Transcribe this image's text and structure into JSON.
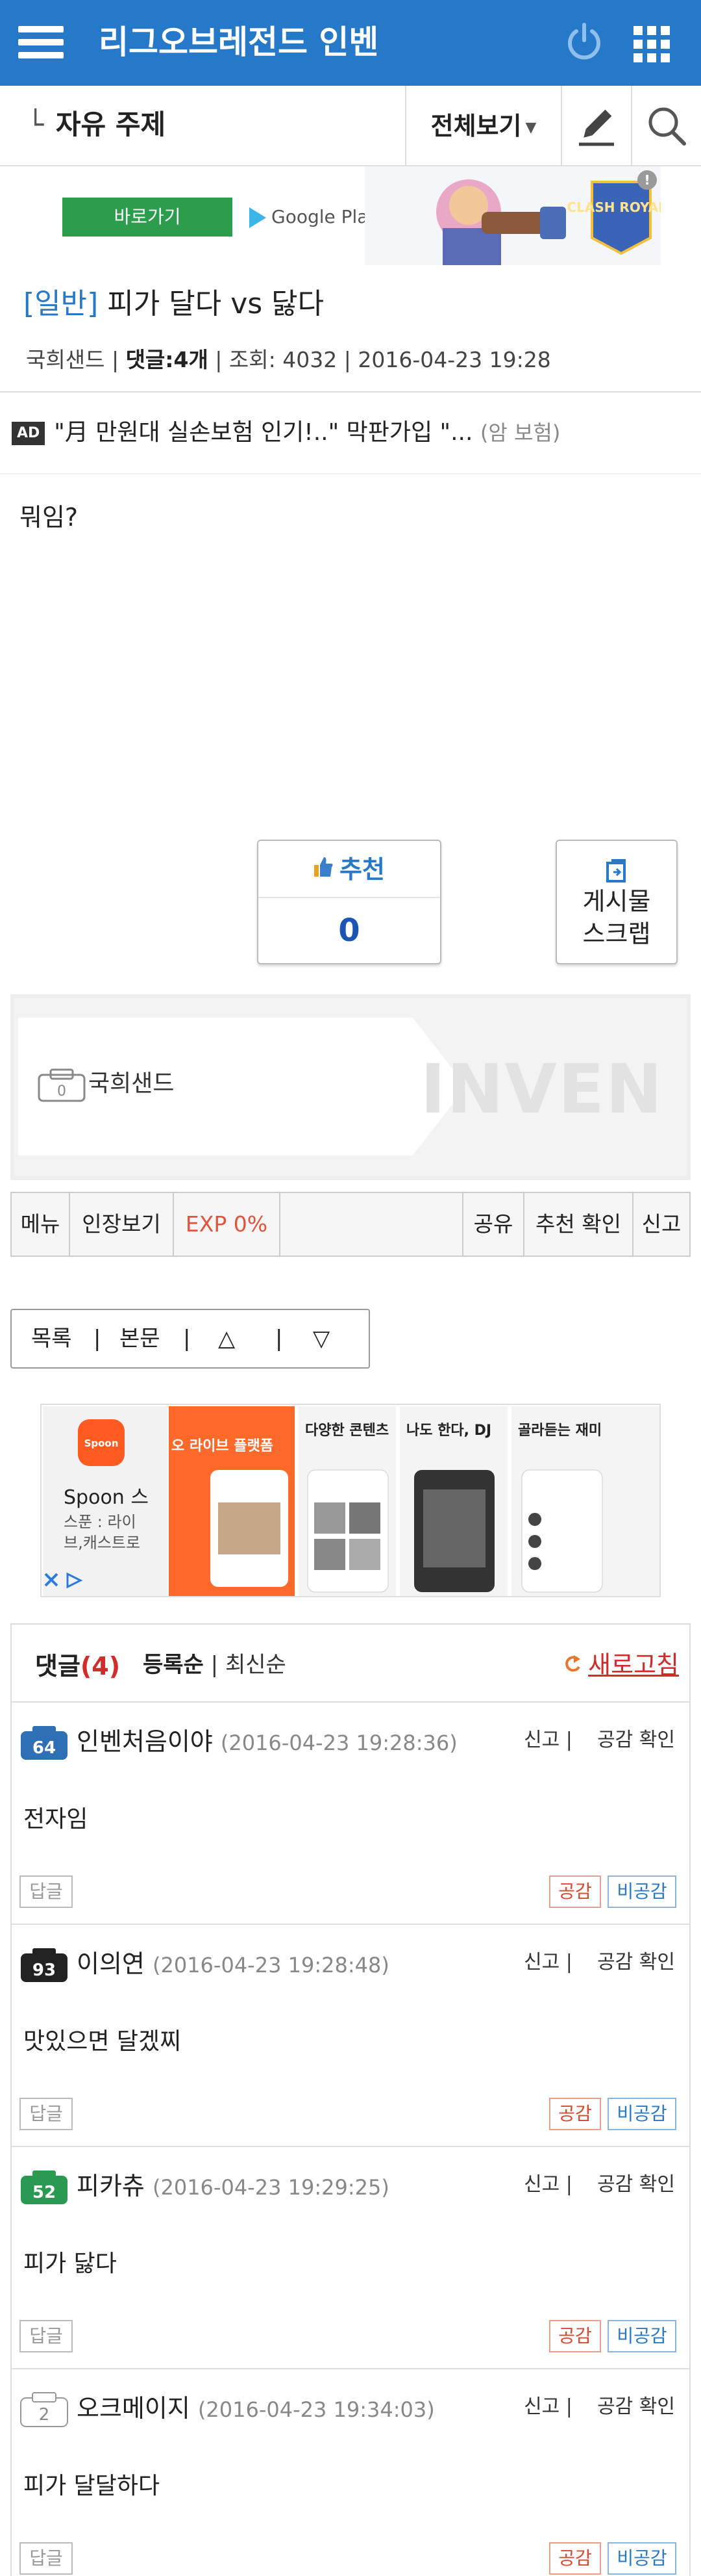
{
  "app": {
    "title": "리그오브레전드 인벤"
  },
  "subnav": {
    "breadcrumb_mark": "└",
    "board": "자유 주제",
    "view_all": "전체보기",
    "caret": "▼"
  },
  "top_ad": {
    "button": "바로가기",
    "store": "Google Play",
    "game_logo": "CLASH ROYALE",
    "info": "!"
  },
  "post": {
    "category": "[일반]",
    "title": "피가 달다 vs 닳다",
    "author": "국희샌드",
    "comments_label": "댓글:",
    "comments_count": "4개",
    "views_label": "조회:",
    "views": "4032",
    "date": "2016-04-23 19:28",
    "body": "뭐임?"
  },
  "text_ad": {
    "tag": "AD",
    "headline": "\"月 만원대 실손보험 인기!..\" 막판가입 \"...",
    "source": "(암 보험)"
  },
  "recommend": {
    "label": "추천",
    "count": "0"
  },
  "scrap": {
    "line1": "게시물",
    "line2": "스크랩"
  },
  "author_box": {
    "name": "국희샌드",
    "watermark": "INVEN"
  },
  "toolbar": {
    "menu": "메뉴",
    "seal": "인장보기",
    "exp": "EXP 0%",
    "share": "공유",
    "rec_check": "추천 확인",
    "report": "신고"
  },
  "nav": {
    "list": "목록",
    "body": "본문",
    "sep": "|",
    "up": "△",
    "down": "▽"
  },
  "spoon_ad": {
    "brand": "Spoon",
    "name": "Spoon 스",
    "desc1": "스푼 : 라이",
    "desc2": "브,캐스트로",
    "banner": "오 라이브 플랫폼",
    "shot2_title": "다양한 콘텐츠",
    "shot3_title": "나도 한다, DJ",
    "shot4_title": "골라듣는 재미"
  },
  "comments": {
    "title": "댓글",
    "count": "(4)",
    "sort_reg": "등록순",
    "sort_sep": "|",
    "sort_new": "최신순",
    "refresh": "새로고침",
    "report": "신고 |",
    "like_check": "공감 확인",
    "reply": "답글",
    "agree": "공감",
    "disagree": "비공감",
    "items": [
      {
        "level": "64",
        "nick": "인벤처음이야",
        "date": "(2016-04-23 19:28:36)",
        "text": "전자임"
      },
      {
        "level": "93",
        "nick": "이의연",
        "date": "(2016-04-23 19:28:48)",
        "text": "맛있으면 달겠찌"
      },
      {
        "level": "52",
        "nick": "피카츄",
        "date": "(2016-04-23 19:29:25)",
        "text": "피가 닳다"
      },
      {
        "level": "2",
        "nick": "오크메이지",
        "date": "(2016-04-23 19:34:03)",
        "text": "피가 달달하다"
      }
    ]
  },
  "colors": {
    "brand": "#2679c8",
    "accent_red": "#d32a2a",
    "exp": "#e2533d"
  }
}
